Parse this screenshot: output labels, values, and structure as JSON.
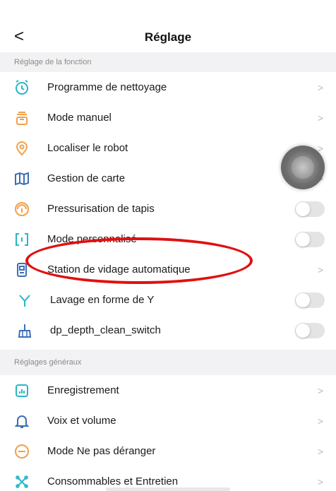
{
  "header": {
    "back_icon": "chevron-left-icon",
    "title": "Réglage"
  },
  "sections": {
    "function": {
      "title": "Réglage de la fonction",
      "items": [
        {
          "label": "Programme de nettoyage",
          "icon": "clock-icon",
          "control": "chevron"
        },
        {
          "label": "Mode manuel",
          "icon": "remote-control-icon",
          "control": "chevron"
        },
        {
          "label": "Localiser le robot",
          "icon": "location-pin-icon",
          "control": "chevron"
        },
        {
          "label": "Gestion de carte",
          "icon": "map-icon",
          "control": "chevron"
        },
        {
          "label": "Pressurisation de tapis",
          "icon": "carpet-boost-icon",
          "control": "toggle",
          "state": "off"
        },
        {
          "label": "Mode personnalisé",
          "icon": "custom-mode-icon",
          "control": "toggle",
          "state": "off"
        },
        {
          "label": "Station de vidage automatique",
          "icon": "dock-station-icon",
          "control": "chevron"
        },
        {
          "label": "Lavage en forme de Y",
          "icon": "y-pattern-icon",
          "control": "toggle",
          "state": "off"
        },
        {
          "label": "dp_depth_clean_switch",
          "icon": "broom-icon",
          "control": "toggle",
          "state": "off"
        }
      ]
    },
    "general": {
      "title": "Réglages généraux",
      "items": [
        {
          "label": "Enregistrement",
          "icon": "record-chart-icon",
          "control": "chevron"
        },
        {
          "label": "Voix et volume",
          "icon": "bell-icon",
          "control": "chevron"
        },
        {
          "label": "Mode Ne pas déranger",
          "icon": "do-not-disturb-icon",
          "control": "chevron"
        },
        {
          "label": "Consommables et Entretien",
          "icon": "consumables-icon",
          "control": "chevron"
        }
      ]
    }
  },
  "chevron_glyph": ">",
  "colors": {
    "accent": "#28b5c8",
    "orange": "#f3a04a",
    "highlight": "#e01010",
    "toggle_off": "#e4e4e6"
  }
}
